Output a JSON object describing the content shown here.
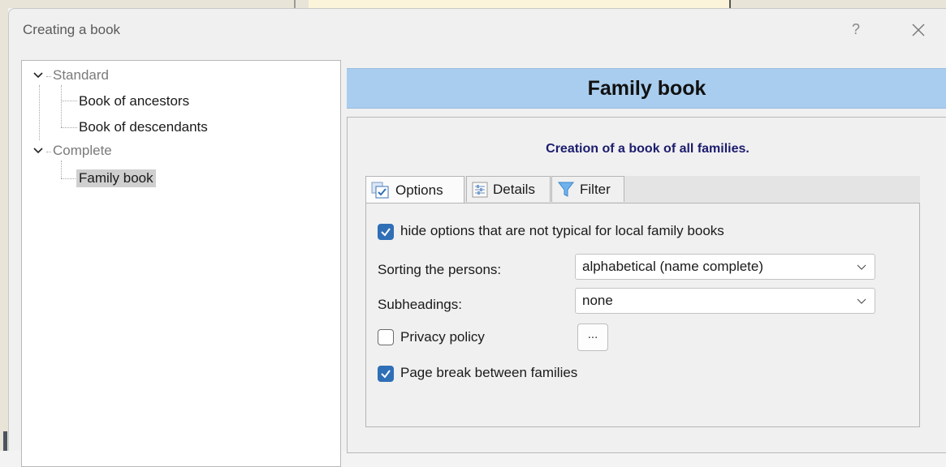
{
  "window": {
    "title": "Creating a book",
    "help_label": "?"
  },
  "tree": {
    "groups": [
      {
        "label": "Standard",
        "children": [
          "Book of ancestors",
          "Book of descendants"
        ]
      },
      {
        "label": "Complete",
        "children": [
          "Family book"
        ]
      }
    ],
    "selected": "Family book"
  },
  "header": {
    "title": "Family book",
    "background_color": "#a9cdee"
  },
  "description": "Creation of a book of all families.",
  "tabs": [
    {
      "label": "Options",
      "icon": "options-checkbox-icon",
      "active": true
    },
    {
      "label": "Details",
      "icon": "details-list-icon",
      "active": false
    },
    {
      "label": "Filter",
      "icon": "funnel-filter-icon",
      "active": false
    }
  ],
  "options": {
    "hide_atypical": {
      "label": "hide options that are not typical for local family books",
      "checked": true
    },
    "sorting": {
      "label": "Sorting the persons:",
      "value": "alphabetical (name complete)"
    },
    "subheadings": {
      "label": "Subheadings:",
      "value": "none"
    },
    "privacy": {
      "label": "Privacy policy",
      "checked": false,
      "button_label": "..."
    },
    "page_break": {
      "label": "Page break between families",
      "checked": true
    }
  },
  "colors": {
    "accent": "#2f6fb6",
    "description_text": "#1c1c6e"
  }
}
